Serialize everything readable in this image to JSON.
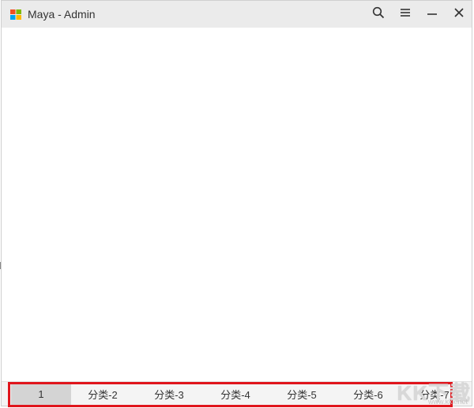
{
  "window": {
    "title": "Maya - Admin",
    "logo_icon": "windows-logo-icon",
    "controls": {
      "search_icon": "search-icon",
      "menu_icon": "hamburger-menu-icon",
      "minimize_icon": "minimize-icon",
      "close_icon": "close-icon"
    }
  },
  "tabs": [
    {
      "label": "1",
      "active": true
    },
    {
      "label": "分类-2",
      "active": false
    },
    {
      "label": "分类-3",
      "active": false
    },
    {
      "label": "分类-4",
      "active": false
    },
    {
      "label": "分类-5",
      "active": false
    },
    {
      "label": "分类-6",
      "active": false
    },
    {
      "label": "分类-7",
      "active": false
    }
  ],
  "watermark": {
    "main": "KK下载",
    "sub": "www.kkx.net"
  },
  "colors": {
    "highlight": "#e0151c",
    "titlebar": "#ebebeb",
    "active_tab": "#d4d4d4"
  }
}
